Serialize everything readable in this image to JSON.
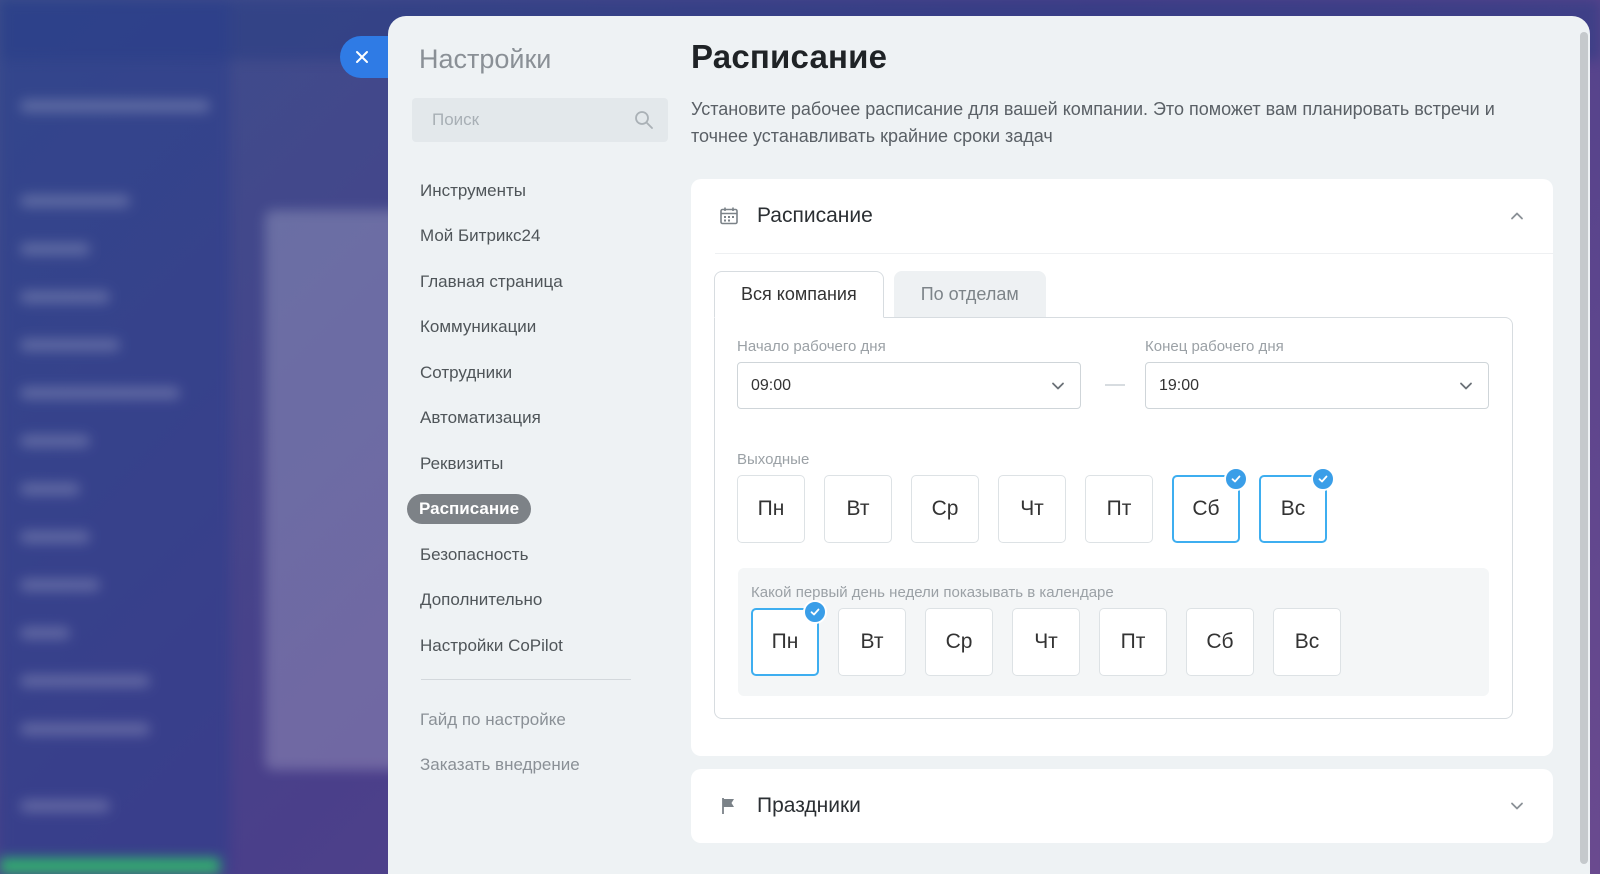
{
  "close_icon": "close-icon",
  "settings": {
    "title": "Настройки",
    "search_placeholder": "Поиск",
    "menu": [
      {
        "label": "Инструменты"
      },
      {
        "label": "Мой Битрикс24"
      },
      {
        "label": "Главная страница"
      },
      {
        "label": "Коммуникации"
      },
      {
        "label": "Сотрудники"
      },
      {
        "label": "Автоматизация"
      },
      {
        "label": "Реквизиты"
      },
      {
        "label": "Расписание",
        "active": true
      },
      {
        "label": "Безопасность"
      },
      {
        "label": "Дополнительно"
      },
      {
        "label": "Настройки CoPilot"
      }
    ],
    "extra": [
      {
        "label": "Гайд по настройке"
      },
      {
        "label": "Заказать внедрение"
      }
    ]
  },
  "main": {
    "title": "Расписание",
    "description": "Установите рабочее расписание для вашей компании. Это поможет вам планировать встречи и точнее устанавливать крайние сроки задач",
    "schedule_card": {
      "title": "Расписание",
      "icon": "calendar-icon",
      "tabs": [
        {
          "label": "Вся компания",
          "active": true
        },
        {
          "label": "По отделам",
          "active": false
        }
      ],
      "work_start": {
        "label": "Начало рабочего дня",
        "value": "09:00"
      },
      "work_end": {
        "label": "Конец рабочего дня",
        "value": "19:00"
      },
      "weekends": {
        "label": "Выходные",
        "days": [
          {
            "label": "Пн",
            "checked": false
          },
          {
            "label": "Вт",
            "checked": false
          },
          {
            "label": "Ср",
            "checked": false
          },
          {
            "label": "Чт",
            "checked": false
          },
          {
            "label": "Пт",
            "checked": false
          },
          {
            "label": "Сб",
            "checked": true
          },
          {
            "label": "Вс",
            "checked": true
          }
        ]
      },
      "first_day": {
        "label": "Какой первый день недели показывать в календаре",
        "days": [
          {
            "label": "Пн",
            "checked": true
          },
          {
            "label": "Вт",
            "checked": false
          },
          {
            "label": "Ср",
            "checked": false
          },
          {
            "label": "Чт",
            "checked": false
          },
          {
            "label": "Пт",
            "checked": false
          },
          {
            "label": "Сб",
            "checked": false
          },
          {
            "label": "Вс",
            "checked": false
          }
        ]
      }
    },
    "holidays_card": {
      "title": "Праздники",
      "icon": "flag-icon"
    }
  },
  "colors": {
    "accent": "#2f7be5",
    "check": "#3a9ee8",
    "active_menu": "#7d8287"
  }
}
